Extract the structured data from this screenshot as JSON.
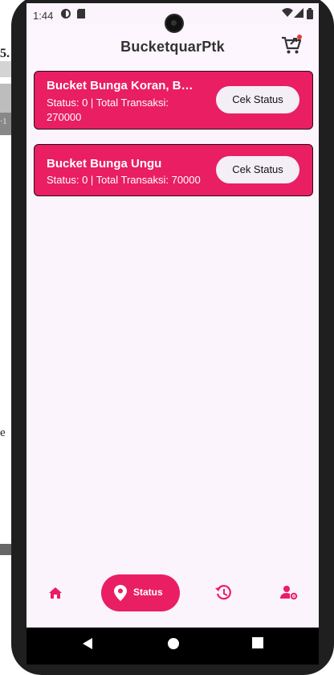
{
  "background_fragments": [
    "5.",
    "·1",
    "e"
  ],
  "status_bar": {
    "time": "1:44"
  },
  "app_bar": {
    "title": "BucketquarPtk"
  },
  "orders": [
    {
      "title": "Bucket Bunga Koran, Buck...",
      "status_line": "Status: 0 | Total Transaksi:",
      "status_line_2": "270000",
      "button": "Cek Status"
    },
    {
      "title": "Bucket Bunga Ungu",
      "status_line": "Status: 0 | Total Transaksi: 70000",
      "status_line_2": "",
      "button": "Cek Status"
    }
  ],
  "bottom_nav": {
    "active_label": "Status"
  },
  "colors": {
    "accent": "#e91e63",
    "screen_bg": "#fcf4fd"
  },
  "icons": [
    "cart-icon",
    "home-icon",
    "location-pin-icon",
    "history-icon",
    "user-settings-icon"
  ]
}
